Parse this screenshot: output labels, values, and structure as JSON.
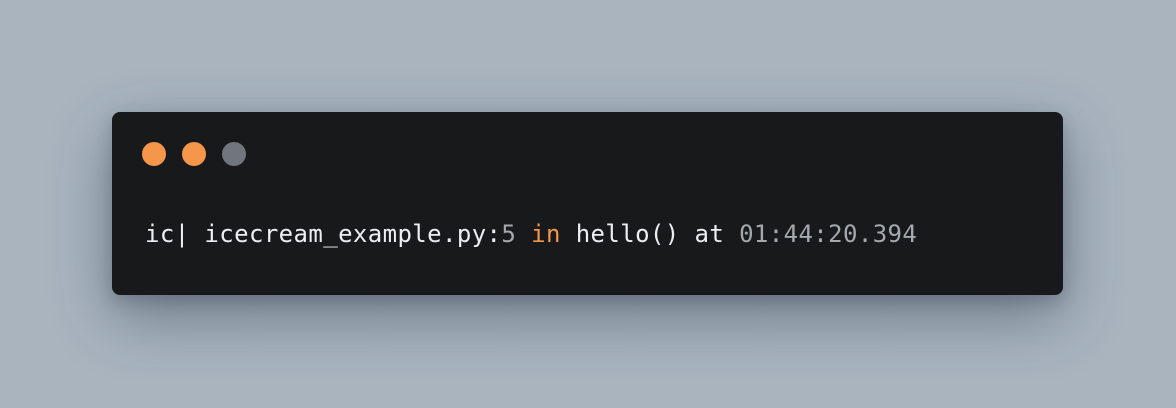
{
  "colors": {
    "background": "#a9b4bf",
    "window": "#18191b",
    "text": "#eceff2",
    "number": "#a3a9b0",
    "keyword": "#f5964a",
    "dot_1": "#f5964a",
    "dot_2": "#f5964a",
    "dot_3": "#70767c"
  },
  "terminal": {
    "prefix": "ic|",
    "file": "icecream_example.py:",
    "line_number": "5",
    "keyword_in": "in",
    "function": "hello()",
    "keyword_at": "at",
    "timestamp": "01:44:20.394"
  }
}
